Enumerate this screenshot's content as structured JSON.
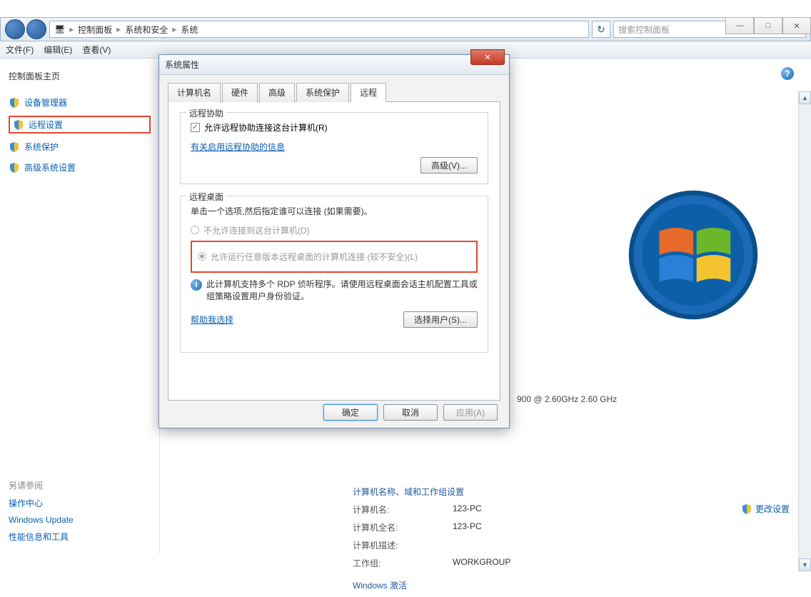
{
  "window_controls": {
    "min": "—",
    "max": "□",
    "close": "✕"
  },
  "explorer": {
    "breadcrumb": [
      "控制面板",
      "系统和安全",
      "系统"
    ],
    "search_placeholder": "搜索控制面板"
  },
  "menu": {
    "file": "文件(F)",
    "edit": "编辑(E)",
    "view": "查看(V)"
  },
  "sidebar": {
    "title": "控制面板主页",
    "items": [
      {
        "label": "设备管理器"
      },
      {
        "label": "远程设置"
      },
      {
        "label": "系统保护"
      },
      {
        "label": "高级系统设置"
      }
    ],
    "bottom": {
      "heading": "另请参阅",
      "links": [
        "操作中心",
        "Windows Update",
        "性能信息和工具"
      ]
    }
  },
  "main": {
    "cpu_tail": "900 @ 2.60GHz  2.60 GHz",
    "change_settings": "更改设置",
    "sys_heading": "计算机名称、域和工作组设置",
    "rows": [
      {
        "label": "计算机名:",
        "val": "123-PC"
      },
      {
        "label": "计算机全名:",
        "val": "123-PC"
      },
      {
        "label": "计算机描述:",
        "val": ""
      },
      {
        "label": "工作组:",
        "val": "WORKGROUP"
      }
    ],
    "activate_heading": "Windows 激活"
  },
  "dialog": {
    "title": "系统属性",
    "tabs": [
      "计算机名",
      "硬件",
      "高级",
      "系统保护",
      "远程"
    ],
    "active_tab": 4,
    "remote_assist": {
      "legend": "远程协助",
      "checkbox": "允许远程协助连接这台计算机(R)",
      "link": "有关启用远程协助的信息",
      "advanced_btn": "高级(V)..."
    },
    "remote_desktop": {
      "legend": "远程桌面",
      "instruction": "单击一个选项,然后指定谁可以连接 (如果需要)。",
      "opt1": "不允许连接到这台计算机(D)",
      "opt2": "允许运行任意版本远程桌面的计算机连接 (较不安全)(L)",
      "info_text": "此计算机支持多个 RDP 侦听程序。请使用远程桌面会话主机配置工具或组策略设置用户身份验证。",
      "help_link": "帮助我选择",
      "select_users_btn": "选择用户(S)..."
    },
    "footer": {
      "ok": "确定",
      "cancel": "取消",
      "apply": "应用(A)"
    }
  }
}
